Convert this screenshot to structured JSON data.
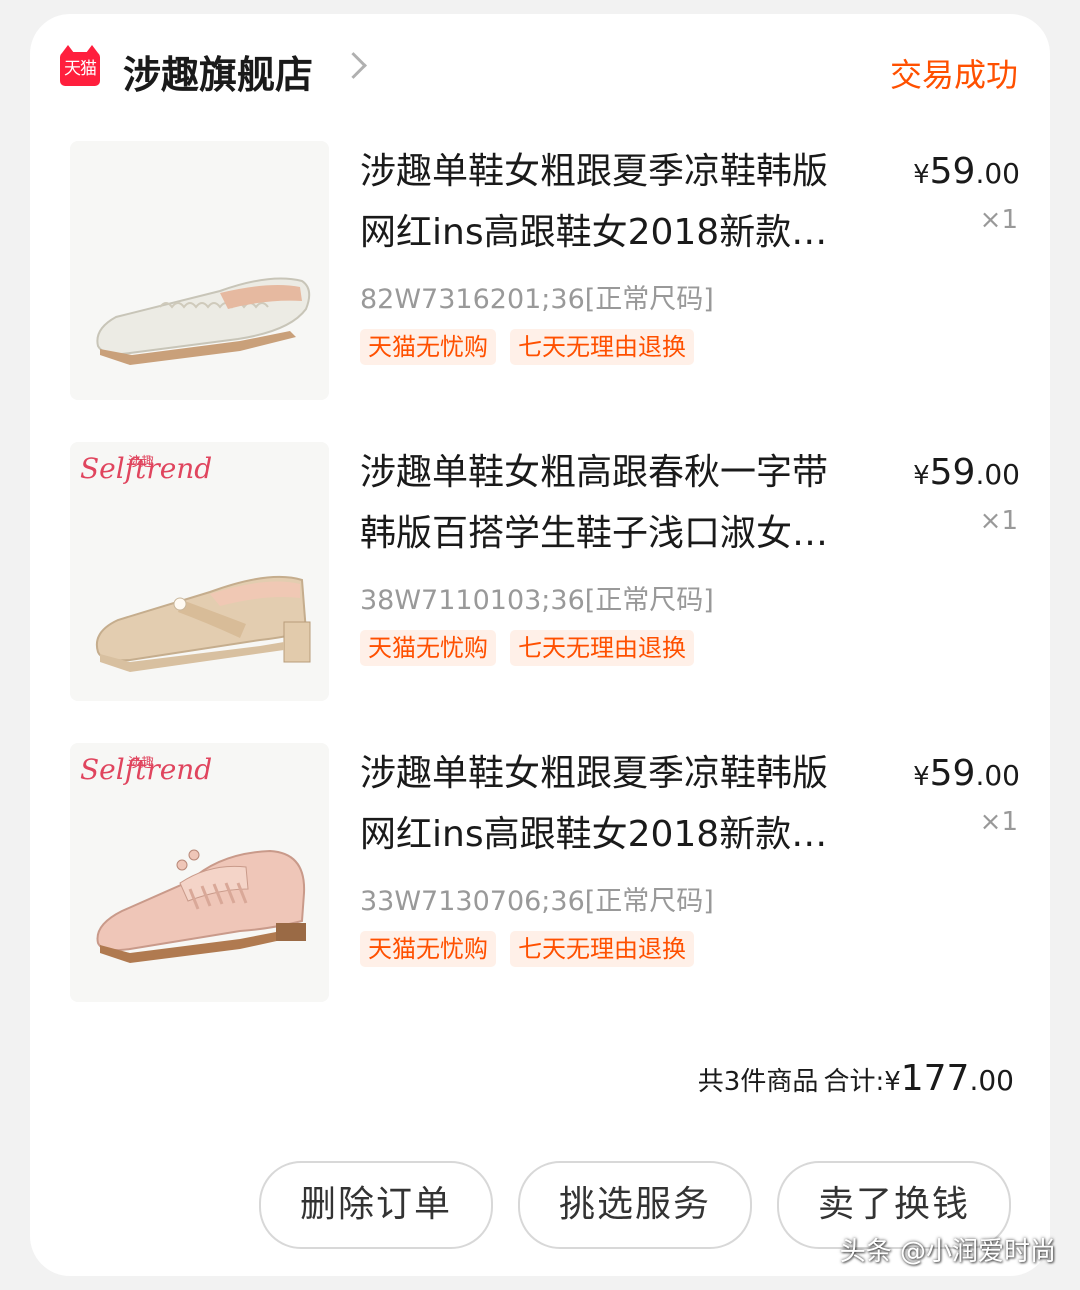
{
  "shop": {
    "logo_text": "天猫",
    "name": "涉趣旗舰店",
    "status": "交易成功"
  },
  "colors": {
    "accent": "#ff5000",
    "tmall_red": "#ff1f3d",
    "tag_bg": "#fff0e8"
  },
  "items": [
    {
      "title_line1": "涉趣单鞋女粗跟夏季凉鞋韩版",
      "title_line2": "网红ins高跟鞋女2018新款…",
      "price_currency": "¥",
      "price_int": "59",
      "price_dec": ".00",
      "qty": "×1",
      "sku": "82W7316201;36[正常尺码]",
      "tag1": "天猫无忧购",
      "tag2": "七天无理由退换",
      "image_icon": "white-flat-shoe-image"
    },
    {
      "title_line1": "涉趣单鞋女粗高跟春秋一字带",
      "title_line2": "韩版百搭学生鞋子浅口淑女…",
      "price_currency": "¥",
      "price_int": "59",
      "price_dec": ".00",
      "qty": "×1",
      "sku": "38W7110103;36[正常尺码]",
      "tag1": "天猫无忧购",
      "tag2": "七天无理由退换",
      "brand_cn": "涉趣",
      "brand_en": "Selftrend",
      "image_icon": "beige-mary-jane-shoe-image"
    },
    {
      "title_line1": "涉趣单鞋女粗跟夏季凉鞋韩版",
      "title_line2": "网红ins高跟鞋女2018新款…",
      "price_currency": "¥",
      "price_int": "59",
      "price_dec": ".00",
      "qty": "×1",
      "sku": "33W7130706;36[正常尺码]",
      "tag1": "天猫无忧购",
      "tag2": "七天无理由退换",
      "brand_cn": "涉趣",
      "brand_en": "Selftrend",
      "image_icon": "pink-oxford-shoe-image"
    }
  ],
  "summary": {
    "count_label": "共3件商品",
    "total_label": "合计:",
    "currency": "¥",
    "total_int": "177",
    "total_dec": ".00"
  },
  "actions": {
    "delete_order": "删除订单",
    "pick_service": "挑选服务",
    "sell_for_cash": "卖了换钱"
  },
  "watermark": "头条 @小润爱时尚"
}
